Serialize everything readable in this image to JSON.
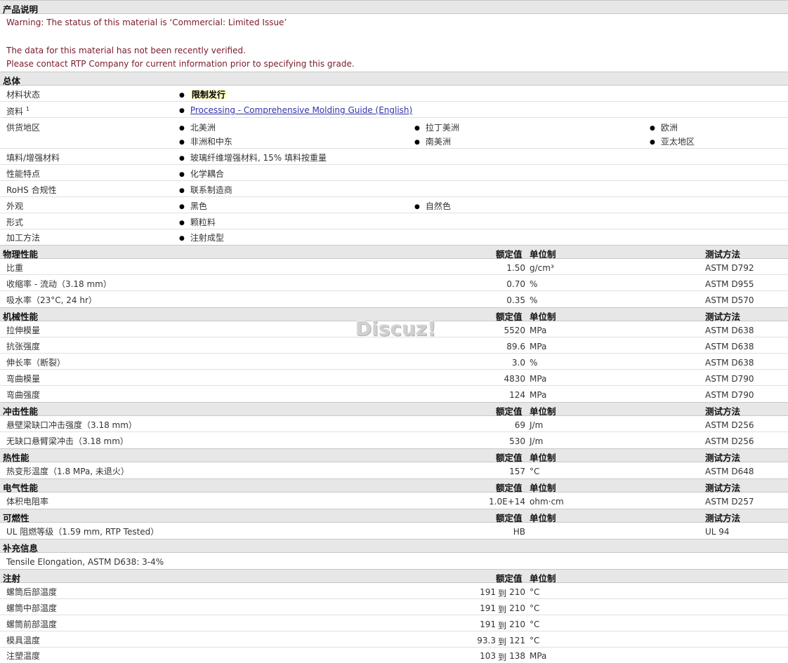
{
  "headers": {
    "nominal": "额定值",
    "unit": "单位制",
    "method": "测试方法"
  },
  "product": {
    "title": "产品说明",
    "warning": "Warning: The status of this material is ‘Commercial: Limited Issue’",
    "note1": "The data for this material has not been recently verified.",
    "note2": "Please contact RTP Company for current information prior to specifying this grade."
  },
  "general": {
    "title": "总体",
    "status_label": "材料状态",
    "status_value": "限制发行",
    "docs_label": "资料",
    "docs_sup": "1",
    "docs_link": "Processing - Comprehensive Molding Guide (English)",
    "supply_label": "供货地区",
    "supply": [
      "北美洲",
      "拉丁美洲",
      "欧洲",
      "非洲和中东",
      "南美洲",
      "亚太地区"
    ],
    "filler_label": "填料/增强材料",
    "filler_value": "玻璃纤维增强材料, 15% 填料按重量",
    "feature_label": "性能特点",
    "feature_value": "化学耦合",
    "rohs_label": "RoHS 合规性",
    "rohs_value": "联系制造商",
    "appearance_label": "外观",
    "appearance": [
      "黑色",
      "自然色"
    ],
    "form_label": "形式",
    "form_value": "颗粒料",
    "process_label": "加工方法",
    "process_value": "注射成型"
  },
  "physical": {
    "title": "物理性能",
    "rows": [
      {
        "label": "比重",
        "value": "1.50",
        "unit": "g/cm³",
        "method": "ASTM D792"
      },
      {
        "label": "收缩率 - 流动（3.18 mm）",
        "value": "0.70",
        "unit": "%",
        "method": "ASTM D955"
      },
      {
        "label": "吸水率（23°C, 24 hr）",
        "value": "0.35",
        "unit": "%",
        "method": "ASTM D570"
      }
    ]
  },
  "mechanical": {
    "title": "机械性能",
    "rows": [
      {
        "label": "拉伸模量",
        "value": "5520",
        "unit": "MPa",
        "method": "ASTM D638"
      },
      {
        "label": "抗张强度",
        "value": "89.6",
        "unit": "MPa",
        "method": "ASTM D638"
      },
      {
        "label": "伸长率（断裂）",
        "value": "3.0",
        "unit": "%",
        "method": "ASTM D638"
      },
      {
        "label": "弯曲模量",
        "value": "4830",
        "unit": "MPa",
        "method": "ASTM D790"
      },
      {
        "label": "弯曲强度",
        "value": "124",
        "unit": "MPa",
        "method": "ASTM D790"
      }
    ]
  },
  "impact": {
    "title": "冲击性能",
    "rows": [
      {
        "label": "悬壁梁缺口冲击强度（3.18 mm）",
        "value": "69",
        "unit": "J/m",
        "method": "ASTM D256"
      },
      {
        "label": "无缺口悬臂梁冲击（3.18 mm）",
        "value": "530",
        "unit": "J/m",
        "method": "ASTM D256"
      }
    ]
  },
  "thermal": {
    "title": "热性能",
    "rows": [
      {
        "label": "热变形温度（1.8 MPa, 未退火）",
        "value": "157",
        "unit": "°C",
        "method": "ASTM D648"
      }
    ]
  },
  "electrical": {
    "title": "电气性能",
    "rows": [
      {
        "label": "体积电阻率",
        "value": "1.0E+14",
        "unit": "ohm·cm",
        "method": "ASTM D257"
      }
    ]
  },
  "flammability": {
    "title": "可燃性",
    "rows": [
      {
        "label": "UL 阻燃等级（1.59 mm, RTP Tested）",
        "value": "HB",
        "unit": "",
        "method": "UL 94"
      }
    ]
  },
  "supplement": {
    "title": "补充信息",
    "text": "Tensile Elongation, ASTM D638: 3-4%"
  },
  "injection": {
    "title": "注射",
    "to": "到",
    "rows": [
      {
        "label": "螺筒后部温度",
        "from": "191",
        "end": "210",
        "unit": "°C"
      },
      {
        "label": "螺筒中部温度",
        "from": "191",
        "end": "210",
        "unit": "°C"
      },
      {
        "label": "螺筒前部温度",
        "from": "191",
        "end": "210",
        "unit": "°C"
      },
      {
        "label": "模具温度",
        "from": "93.3",
        "end": "121",
        "unit": "°C"
      },
      {
        "label": "注塑温度",
        "from": "103",
        "end": "138",
        "unit": "MPa"
      }
    ]
  },
  "watermark": "Discuz!"
}
